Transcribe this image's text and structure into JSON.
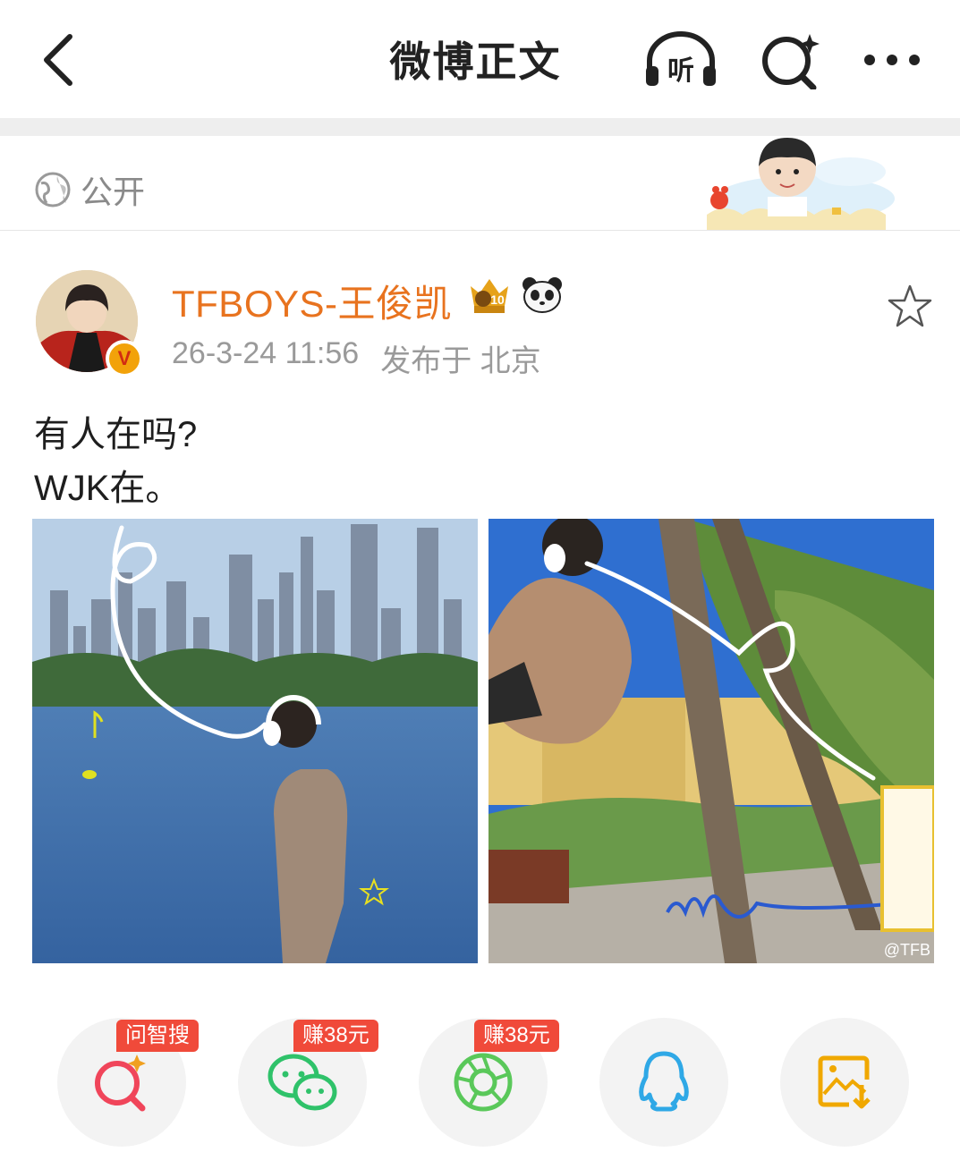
{
  "header": {
    "title": "微博正文",
    "listen_label": "听"
  },
  "visibility": {
    "label": "公开"
  },
  "post": {
    "author": "TFBOYS-王俊凯",
    "verified_badge": "V",
    "date": "26-3-24 11:56",
    "location": "发布于 北京",
    "text_line1": "有人在吗?",
    "text_line2": "WJK在。",
    "watermark": "@TFB"
  },
  "share": {
    "items": [
      {
        "icon": "search-sparkle-icon",
        "tag": "问智搜",
        "color": "#f0455a"
      },
      {
        "icon": "wechat-icon",
        "tag": "赚38元",
        "color": "#2fc26a"
      },
      {
        "icon": "moments-icon",
        "tag": "赚38元",
        "color": "#5ac85a"
      },
      {
        "icon": "qq-icon",
        "tag": "",
        "color": "#2fa8e6"
      },
      {
        "icon": "save-image-icon",
        "tag": "",
        "color": "#f0a800"
      }
    ]
  },
  "colors": {
    "username": "#e8731f",
    "tag_bg": "#f04a3a",
    "meta": "#9a9a9a"
  }
}
